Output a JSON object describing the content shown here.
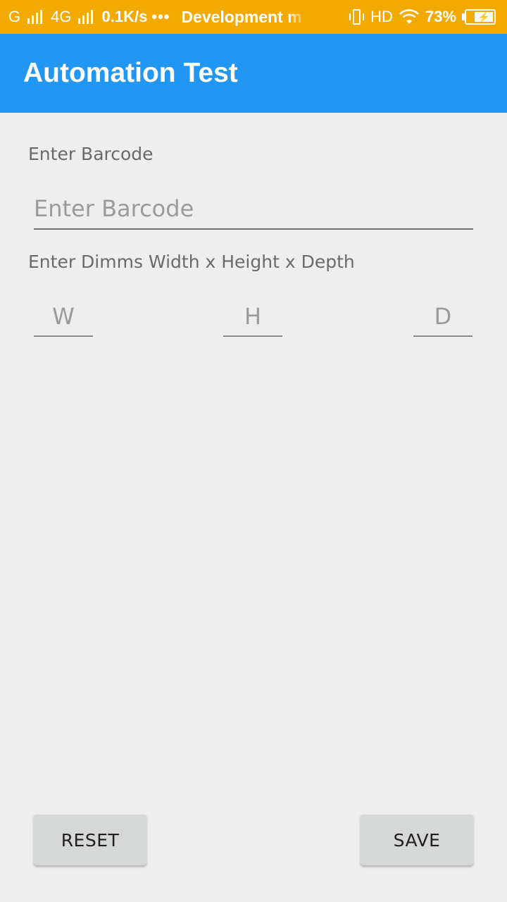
{
  "status_bar": {
    "carrier1": "G",
    "carrier2": "4G",
    "speed": "0.1K/s",
    "dots": "•••",
    "notification": "Development m",
    "hd": "HD",
    "battery_percent": "73%",
    "battery_level": 0.73
  },
  "app_bar": {
    "title": "Automation Test"
  },
  "form": {
    "barcode_label": "Enter Barcode",
    "barcode_placeholder": "Enter Barcode",
    "barcode_value": "",
    "dims_label": "Enter Dimms Width x Height x Depth",
    "width_placeholder": "W",
    "height_placeholder": "H",
    "depth_placeholder": "D"
  },
  "buttons": {
    "reset_label": "RESET",
    "save_label": "SAVE"
  },
  "colors": {
    "status_bar": "#f3aa00",
    "app_bar": "#2196f3",
    "background": "#eeeeee",
    "button": "#d6d7d7"
  },
  "icons": {
    "signal": "cellular-signal-icon",
    "vibrate": "vibrate-icon",
    "wifi": "wifi-icon",
    "battery": "battery-charging-icon"
  }
}
